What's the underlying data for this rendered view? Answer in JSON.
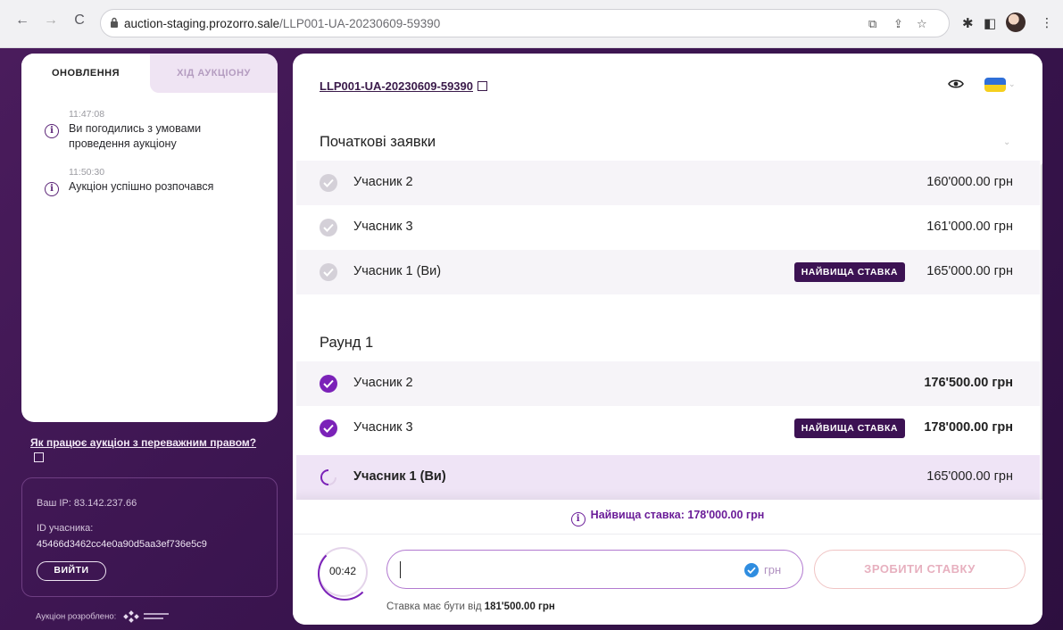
{
  "browser": {
    "url_host": "auction-staging.prozorro.sale",
    "url_path": "/LLP001-UA-20230609-59390"
  },
  "sidebar": {
    "tabs": [
      {
        "label": "ОНОВЛЕННЯ",
        "active": true
      },
      {
        "label": "ХІД АУКЦІОНУ",
        "active": false
      }
    ],
    "log": [
      {
        "time": "11:47:08",
        "text": "Ви погодились з умовами проведення аукціону"
      },
      {
        "time": "11:50:30",
        "text": "Аукціон успішно розпочався"
      }
    ],
    "rules_link": "Як працює аукціон з переважним правом?",
    "user": {
      "ip": "Ваш IP: 83.142.237.66",
      "id_label": "ID учасника:",
      "id_value": "45466d3462cc4e0a90d5aa3ef736e5c9",
      "logout_label": "ВИЙТИ"
    },
    "developed_by": "Аукціон розроблено:"
  },
  "main": {
    "lot_id": "LLP001-UA-20230609-59390",
    "sections": [
      {
        "title": "Початкові заявки",
        "rows": [
          {
            "name": "Учасник 2",
            "amount": "160'000.00 грн",
            "status": "done-grey",
            "badge": ""
          },
          {
            "name": "Учасник 3",
            "amount": "161'000.00 грн",
            "status": "done-grey",
            "badge": ""
          },
          {
            "name": "Учасник 1 (Ви)",
            "amount": "165'000.00 грн",
            "status": "done-grey",
            "badge": "НАЙВИЩА СТАВКА"
          }
        ]
      },
      {
        "title": "Раунд 1",
        "rows": [
          {
            "name": "Учасник 2",
            "amount": "176'500.00 грн",
            "status": "done-purple",
            "badge": ""
          },
          {
            "name": "Учасник 3",
            "amount": "178'000.00 грн",
            "status": "done-purple",
            "badge": "НАЙВИЩА СТАВКА"
          },
          {
            "name": "Учасник 1 (Ви)",
            "amount": "165'000.00 грн",
            "status": "in-progress",
            "badge": ""
          }
        ]
      }
    ],
    "top_bid_info": "Найвища ставка: 178'000.00 грн",
    "timer": "00:42",
    "bid_input": {
      "value": "",
      "currency": "грн"
    },
    "submit_label": "ЗРОБИТИ СТАВКУ",
    "min_bid_text": "Ставка має бути від",
    "min_bid_value": "181'500.00 грн"
  },
  "colors": {
    "accent": "#7b22b8",
    "badge_bg": "#3c1253",
    "page_bg": "#3b1550"
  }
}
